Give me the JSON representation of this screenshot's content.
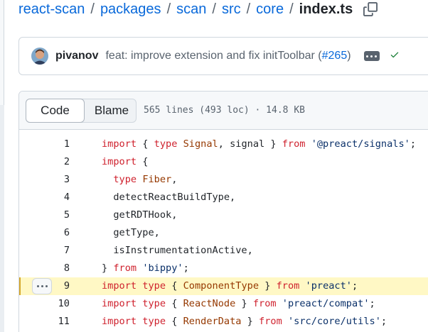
{
  "breadcrumb": {
    "parts": [
      "react-scan",
      "packages",
      "scan",
      "src",
      "core"
    ],
    "separator": "/",
    "current": "index.ts"
  },
  "commit": {
    "author": "pivanov",
    "message": "feat: improve extension and fix initToolbar (",
    "pr": "#265",
    "message_end": ")"
  },
  "file_header": {
    "tabs": [
      "Code",
      "Blame"
    ],
    "active_tab": "Code",
    "meta": "565 lines (493 loc) · 14.8 KB"
  },
  "code": {
    "highlighted_line": 9,
    "lines": [
      {
        "num": "1",
        "tokens": [
          {
            "t": "k",
            "v": "import"
          },
          {
            "t": "p",
            "v": " { "
          },
          {
            "t": "k",
            "v": "type"
          },
          {
            "t": "p",
            "v": " "
          },
          {
            "t": "t",
            "v": "Signal"
          },
          {
            "t": "p",
            "v": ", signal } "
          },
          {
            "t": "k",
            "v": "from"
          },
          {
            "t": "p",
            "v": " "
          },
          {
            "t": "s",
            "v": "'@preact/signals'"
          },
          {
            "t": "p",
            "v": ";"
          }
        ]
      },
      {
        "num": "2",
        "tokens": [
          {
            "t": "k",
            "v": "import"
          },
          {
            "t": "p",
            "v": " {"
          }
        ]
      },
      {
        "num": "3",
        "tokens": [
          {
            "t": "p",
            "v": "  "
          },
          {
            "t": "k",
            "v": "type"
          },
          {
            "t": "p",
            "v": " "
          },
          {
            "t": "t",
            "v": "Fiber"
          },
          {
            "t": "p",
            "v": ","
          }
        ]
      },
      {
        "num": "4",
        "tokens": [
          {
            "t": "p",
            "v": "  detectReactBuildType,"
          }
        ]
      },
      {
        "num": "5",
        "tokens": [
          {
            "t": "p",
            "v": "  getRDTHook,"
          }
        ]
      },
      {
        "num": "6",
        "tokens": [
          {
            "t": "p",
            "v": "  getType,"
          }
        ]
      },
      {
        "num": "7",
        "tokens": [
          {
            "t": "p",
            "v": "  isInstrumentationActive,"
          }
        ]
      },
      {
        "num": "8",
        "tokens": [
          {
            "t": "p",
            "v": "} "
          },
          {
            "t": "k",
            "v": "from"
          },
          {
            "t": "p",
            "v": " "
          },
          {
            "t": "s",
            "v": "'bippy'"
          },
          {
            "t": "p",
            "v": ";"
          }
        ]
      },
      {
        "num": "9",
        "tokens": [
          {
            "t": "k",
            "v": "import"
          },
          {
            "t": "p",
            "v": " "
          },
          {
            "t": "k",
            "v": "type"
          },
          {
            "t": "p",
            "v": " { "
          },
          {
            "t": "t",
            "v": "ComponentType"
          },
          {
            "t": "p",
            "v": " } "
          },
          {
            "t": "k",
            "v": "from"
          },
          {
            "t": "p",
            "v": " "
          },
          {
            "t": "s",
            "v": "'preact'"
          },
          {
            "t": "p",
            "v": ";"
          }
        ]
      },
      {
        "num": "10",
        "tokens": [
          {
            "t": "k",
            "v": "import"
          },
          {
            "t": "p",
            "v": " "
          },
          {
            "t": "k",
            "v": "type"
          },
          {
            "t": "p",
            "v": " { "
          },
          {
            "t": "t",
            "v": "ReactNode"
          },
          {
            "t": "p",
            "v": " } "
          },
          {
            "t": "k",
            "v": "from"
          },
          {
            "t": "p",
            "v": " "
          },
          {
            "t": "s",
            "v": "'preact/compat'"
          },
          {
            "t": "p",
            "v": ";"
          }
        ]
      },
      {
        "num": "11",
        "tokens": [
          {
            "t": "k",
            "v": "import"
          },
          {
            "t": "p",
            "v": " "
          },
          {
            "t": "k",
            "v": "type"
          },
          {
            "t": "p",
            "v": " { "
          },
          {
            "t": "t",
            "v": "RenderData"
          },
          {
            "t": "p",
            "v": " } "
          },
          {
            "t": "k",
            "v": "from"
          },
          {
            "t": "p",
            "v": " "
          },
          {
            "t": "s",
            "v": "'src/core/utils'"
          },
          {
            "t": "p",
            "v": ";"
          }
        ]
      }
    ]
  },
  "colors": {
    "link": "#0969da",
    "keyword": "#cf222e",
    "string": "#0a3069",
    "type": "#953800",
    "highlight": "#fff8c5"
  },
  "icons": [
    "copy-icon",
    "avatar",
    "ellipsis-icon",
    "check-icon"
  ]
}
